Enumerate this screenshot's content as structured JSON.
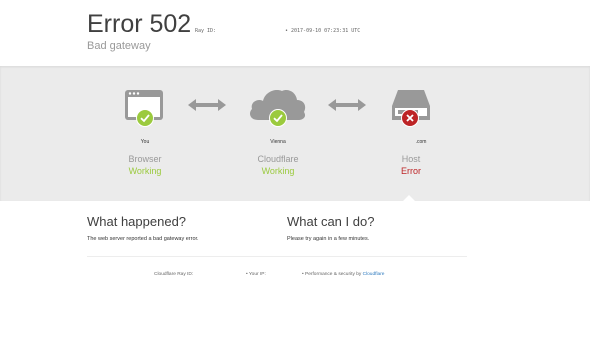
{
  "header": {
    "title": "Error 502",
    "ray_label": "Ray ID:",
    "timestamp": "• 2017-09-10 07:23:31 UTC",
    "subtitle": "Bad gateway"
  },
  "nodes": [
    {
      "location": "You",
      "name": "Browser",
      "status": "Working",
      "icon": "browser-icon",
      "badge": "check"
    },
    {
      "location": "Vienna",
      "name": "Cloudflare",
      "status": "Working",
      "icon": "cloud-icon",
      "badge": "check"
    },
    {
      "location": ".com",
      "name": "Host",
      "status": "Error",
      "icon": "server-icon",
      "badge": "x"
    }
  ],
  "colors": {
    "ok": "#9bca3e",
    "error": "#bd2426",
    "icon_gray": "#999999",
    "link": "#2f7bbf"
  },
  "what_happened": {
    "heading": "What happened?",
    "text": "The web server reported a bad gateway error."
  },
  "what_can_i_do": {
    "heading": "What can I do?",
    "text": "Please try again in a few minutes."
  },
  "footer": {
    "ray_id": "Cloudflare Ray ID:",
    "your_ip": "• Your IP:",
    "perf_prefix": "• Performance & security by",
    "perf_link": "Cloudflare"
  }
}
